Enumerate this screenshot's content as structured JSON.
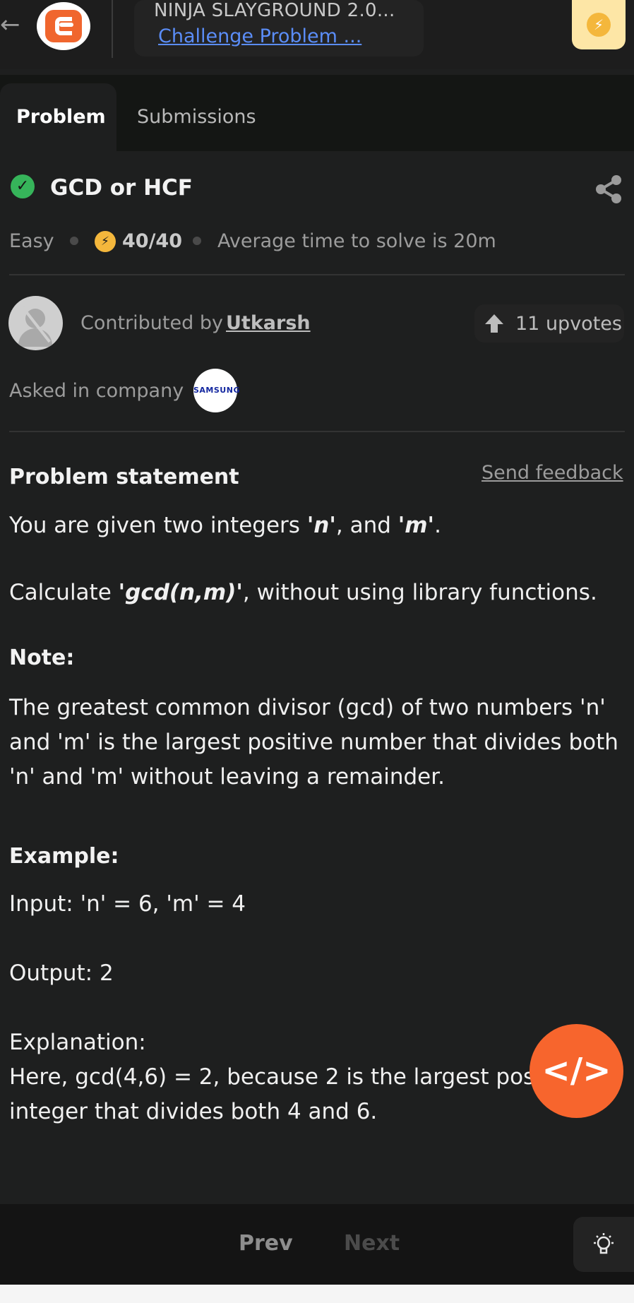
{
  "header": {
    "back_icon": "arrow-left",
    "app_title": "NINJA SLAYGROUND 2.0...",
    "app_subtitle": "Challenge Problem ...",
    "bolt_icon": "lightning-bolt"
  },
  "tabs": [
    {
      "label": "Problem",
      "active": true
    },
    {
      "label": "Submissions",
      "active": false
    }
  ],
  "problem": {
    "status_icon": "check-circle",
    "title": "GCD or HCF",
    "difficulty": "Easy",
    "score": "40/40",
    "avg_time": "Average time to solve is 20m",
    "contributed_by_label": "Contributed by",
    "contributor": "Utkarsh",
    "upvotes": "11 upvotes",
    "asked_in_label": "Asked in company",
    "company_logo_text": "SAMSUNG"
  },
  "statement": {
    "heading": "Problem statement",
    "send_feedback": "Send feedback",
    "line1_prefix": "You are given two integers ",
    "line1_n": "'n'",
    "line1_mid": ", and ",
    "line1_m": "'m'",
    "line1_suffix": ".",
    "line2_prefix": "Calculate ",
    "line2_code": "'gcd(n,m)'",
    "line2_suffix": ", without using library functions.",
    "note_heading": "Note:",
    "note_line1": "The greatest common divisor (gcd) of two numbers 'n'",
    "note_line2": "and 'm' is the largest positive number that divides both",
    "note_line3": "'n' and 'm' without leaving a remainder.",
    "example_heading": "Example:",
    "input": "Input: 'n' = 6, 'm' = 4",
    "output": "Output: 2",
    "explanation_label": "Explanation:",
    "explanation_line1": "Here, gcd(4,6) = 2, because 2 is the largest posit",
    "explanation_line2": "integer that divides both 4 and 6."
  },
  "fab": {
    "label": "</>"
  },
  "footer": {
    "prev": "Prev",
    "next": "Next",
    "hint_icon": "lightbulb"
  },
  "colors": {
    "accent": "#f7652d",
    "link": "#5b8df7",
    "success": "#36b45a",
    "coin": "#f4b73c"
  }
}
